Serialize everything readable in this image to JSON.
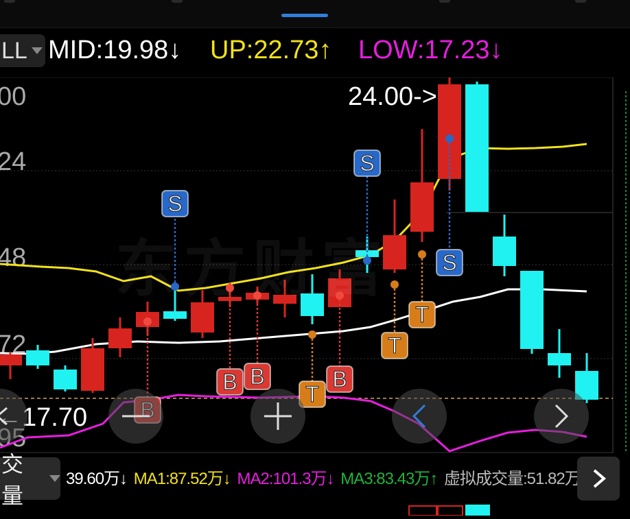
{
  "top_tabs": {
    "active_tab_color": "#2f7ed8"
  },
  "indicator_header": {
    "mode_label": "LL",
    "mid": "MID:19.98",
    "mid_arrow": "↓",
    "up": "UP:22.73",
    "up_arrow": "↑",
    "low": "LOW:17.23",
    "low_arrow": "↓",
    "colors": {
      "mid": "#ffffff",
      "up": "#f2e21a",
      "low": "#e81ee0"
    }
  },
  "price_axis": {
    "labels": [
      "00",
      "24",
      "48",
      "72",
      "95"
    ]
  },
  "annotations": {
    "high_marker": "24.00->",
    "low_marker": "←17.70",
    "current_price_line_color": "#d4a35b"
  },
  "trade_signals": {
    "buy": "B",
    "sell": "S",
    "t": "T"
  },
  "watermark": "东方财富",
  "colors": {
    "up_candle": "#d7241f",
    "down_candle": "#1ff2f0",
    "mid_line": "#ffffff",
    "upper_band": "#f2e21a",
    "lower_band": "#e81ee0",
    "buy_badge": "#d83a33",
    "sell_badge": "#2868c8",
    "t_badge": "#d67d1a"
  },
  "icons": {
    "mode_dropdown": "caret-down-icon",
    "nav_left": "chevron-left-icon",
    "zoom_out": "minus-icon",
    "zoom_in": "plus-icon",
    "scroll_left": "chevron-left-icon",
    "scroll_right": "chevron-right-icon",
    "volume_dropdown": "caret-down-icon",
    "next_panel": "chevron-right-icon"
  },
  "volume_header": {
    "mode_label": "交量",
    "vol": "39.60万↓",
    "ma1": "MA1:87.52万↓",
    "ma2": "MA2:101.3万↓",
    "ma3": "MA3:83.43万↑",
    "virtual": "虚拟成交量:51.82万",
    "colors": {
      "vol": "#ffffff",
      "ma1": "#f2e21a",
      "ma2": "#e81ee0",
      "ma3": "#21b33b",
      "virtual": "#bbbbbb"
    }
  }
}
